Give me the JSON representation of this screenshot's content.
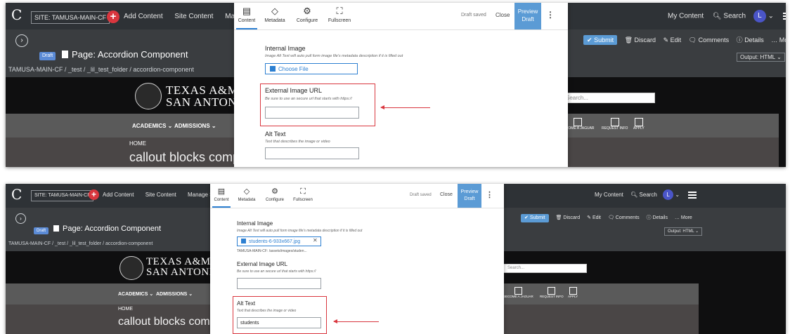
{
  "top_bar": {
    "logo_glyph": "C",
    "site_selector": "SITE: TAMUSA-MAIN-CF",
    "add_content": "Add Content",
    "site_content": "Site Content",
    "manage_site": "Manage Site",
    "my_content": "My Content",
    "search": "Search",
    "avatar_initial": "L"
  },
  "asset": {
    "draft_label": "Draft",
    "page_title": "Page: Accordion Component",
    "breadcrumb": "TAMUSA-MAIN-CF / _test / _lil_test_folder / accordion-component",
    "actions": [
      "Submit",
      "Discard",
      "Edit",
      "Comments",
      "Details",
      "More"
    ],
    "output_selector": "Output: HTML"
  },
  "site_preview": {
    "university_line1": "TEXAS A&M U",
    "university_line2": "SAN ANTONIO",
    "nav_items": [
      "ACADEMICS",
      "ADMISSIONS"
    ],
    "search_placeholder": "Search...",
    "quick_links": [
      "BECOME A JAGUAR",
      "REQUEST INFO",
      "APPLY"
    ],
    "hero_crumb": "HOME",
    "hero_title": "callout blocks compo"
  },
  "editor": {
    "tabs": [
      "Content",
      "Metadata",
      "Configure",
      "Fullscreen"
    ],
    "active_tab": "Content",
    "draft_status": "Draft saved",
    "close": "Close",
    "preview_line1": "Preview",
    "preview_line2": "Draft",
    "internal_image": {
      "label": "Internal Image",
      "help": "Image Alt Text will auto pull form image file's metadata description if it is filled out",
      "choose_button": "Choose File"
    },
    "external_image": {
      "label": "External Image URL",
      "help": "Be sure to use an secure url that starts with https://",
      "value": ""
    },
    "alt_text": {
      "label": "Alt Text",
      "help": "Text that describes the image or video"
    }
  },
  "screenshot_1": {
    "alt_text_value": ""
  },
  "screenshot_2": {
    "selected_file": "students-6-933x667.jpg",
    "file_path": "TAMUSA-MAIN-CF: /assets/images/studen...",
    "alt_text_value": "students"
  },
  "colors": {
    "top_bar": "#2e3236",
    "accent_blue": "#5b9bd5",
    "highlight_red": "#d9363e",
    "banner_black": "#0f0f10"
  }
}
